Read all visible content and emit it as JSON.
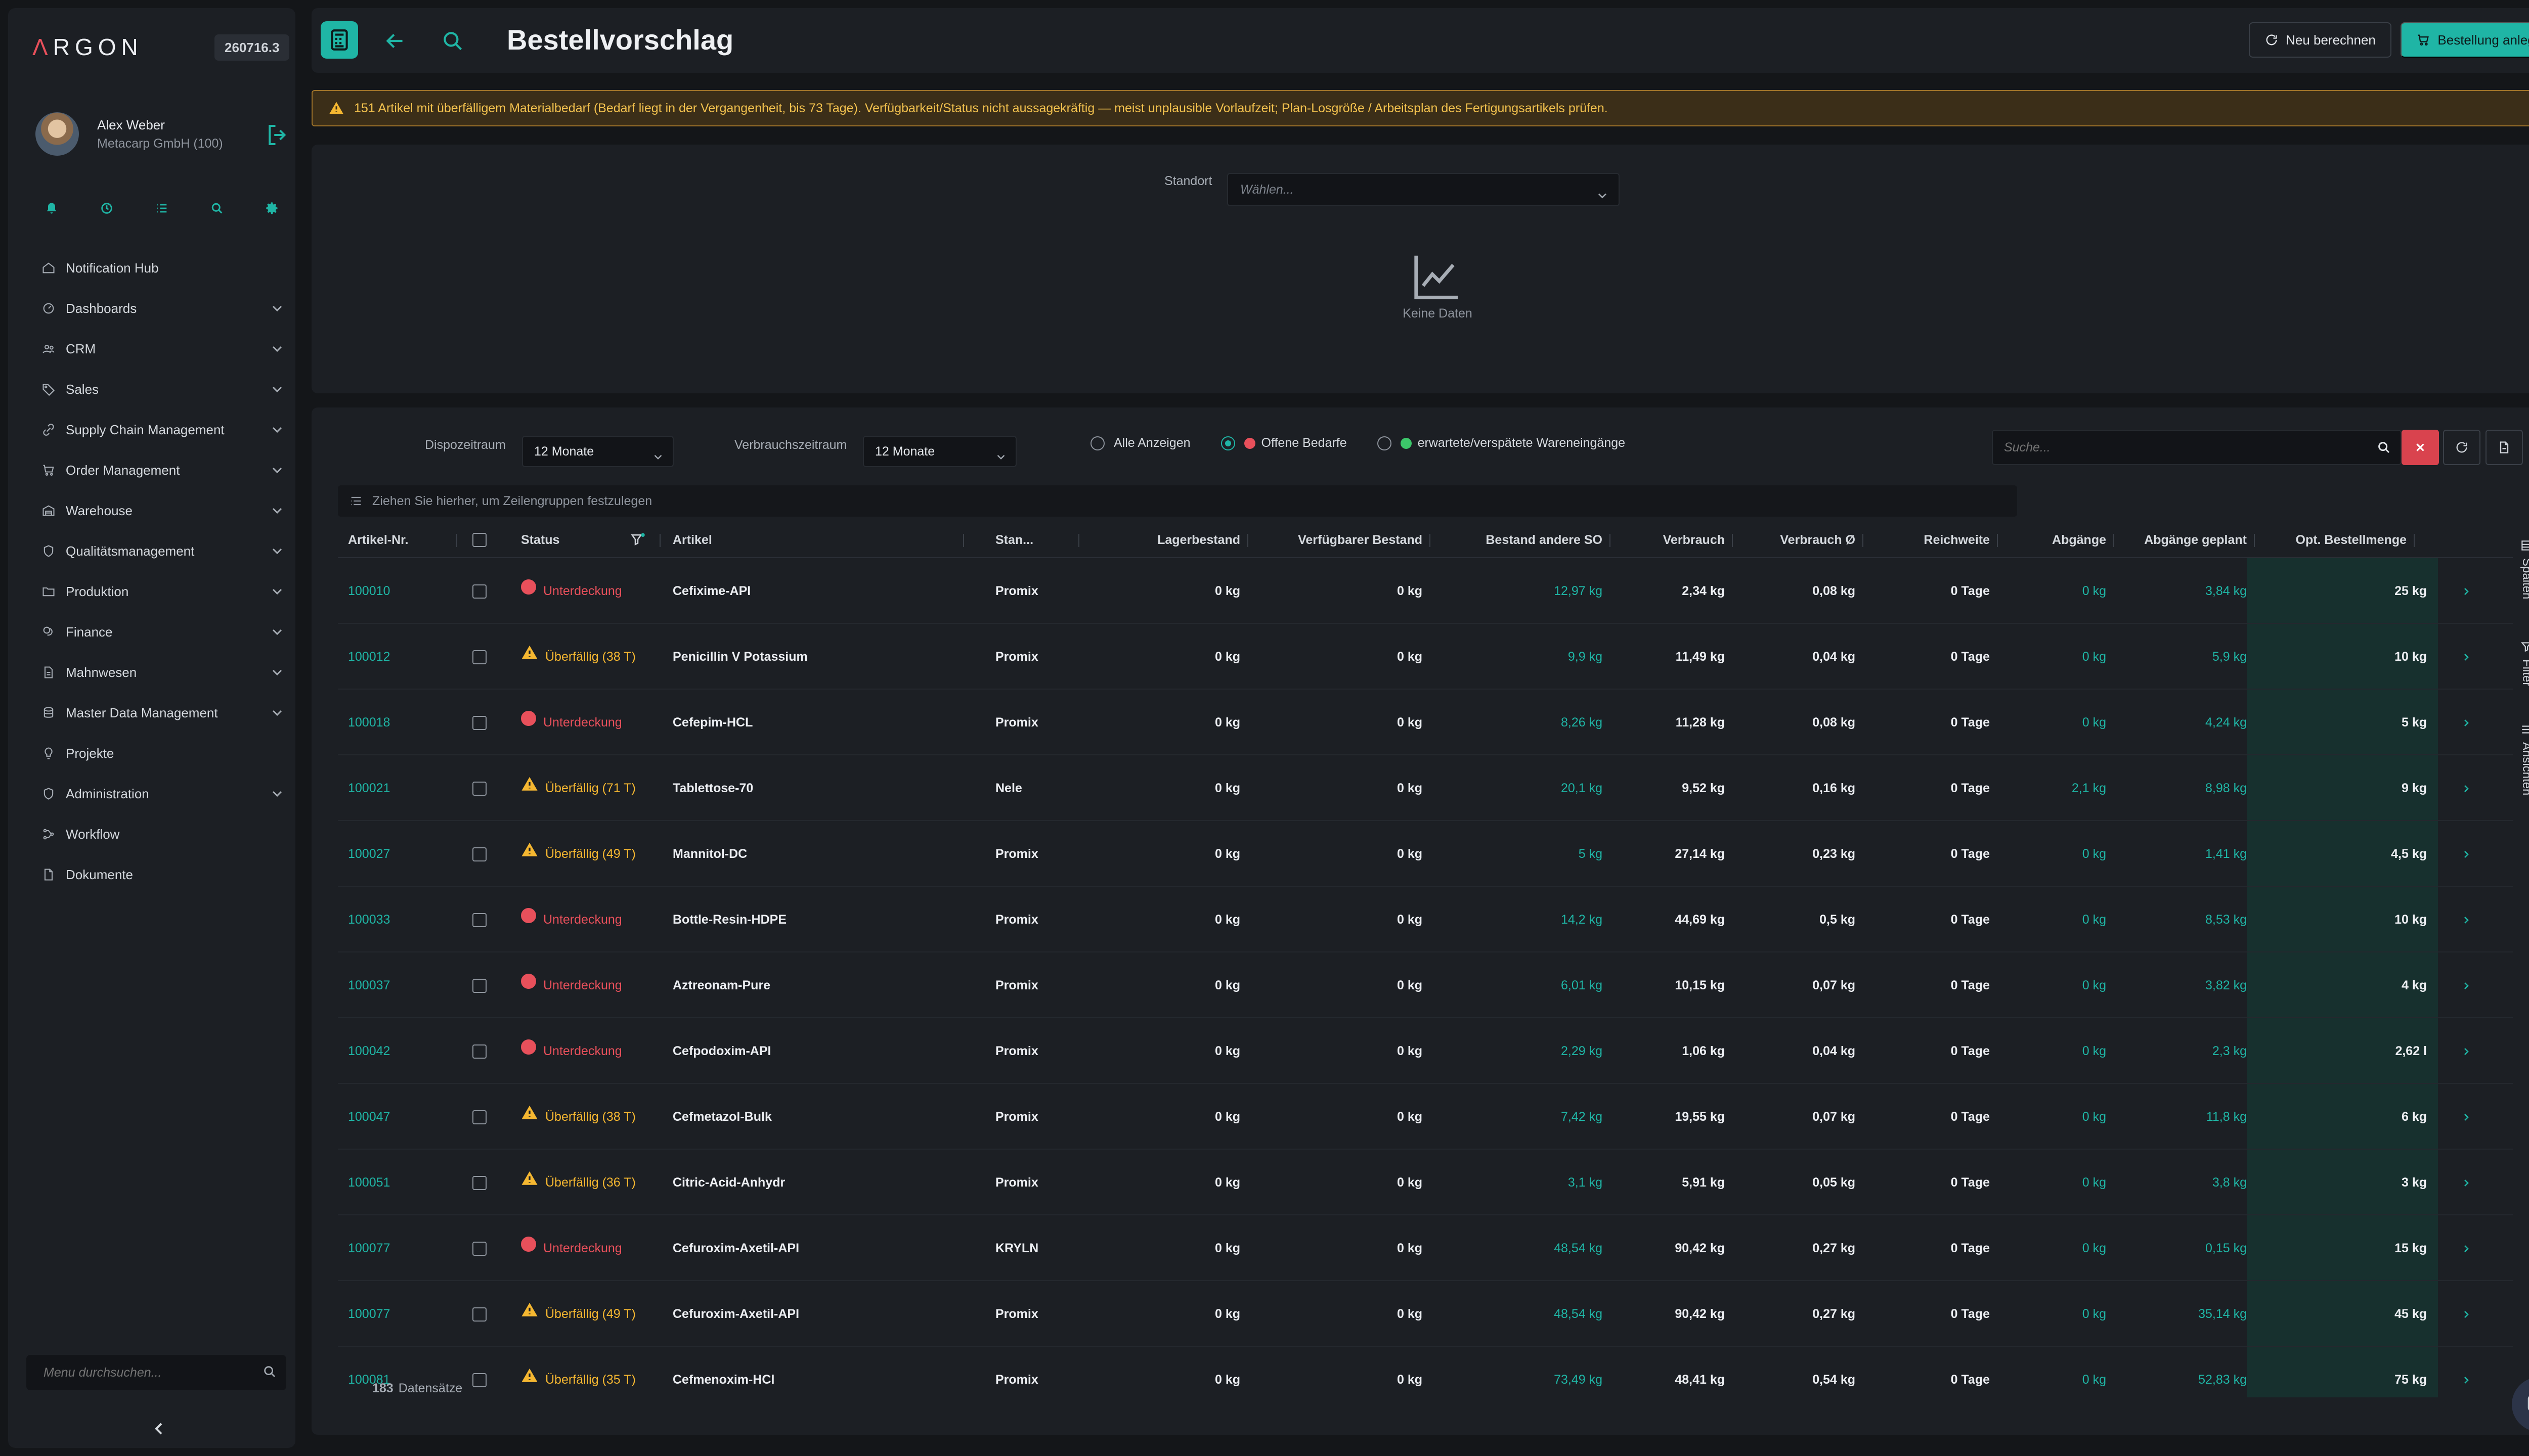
{
  "sidebar": {
    "brand_letter": "Λ",
    "brand_rest": "RGON",
    "version": "260716.3",
    "user_name": "Alex Weber",
    "user_company": "Metacarp GmbH (100)",
    "quick_icons": [
      "bell-icon",
      "clock-icon",
      "list-icon",
      "search-icon",
      "gear-icon"
    ],
    "items": [
      {
        "label": "Notification Hub",
        "icon": "home-icon",
        "expandable": false
      },
      {
        "label": "Dashboards",
        "icon": "gauge-icon",
        "expandable": true
      },
      {
        "label": "CRM",
        "icon": "users-icon",
        "expandable": true
      },
      {
        "label": "Sales",
        "icon": "tag-icon",
        "expandable": true
      },
      {
        "label": "Supply Chain Management",
        "icon": "link-icon",
        "expandable": true
      },
      {
        "label": "Order Management",
        "icon": "cart-icon",
        "expandable": true
      },
      {
        "label": "Warehouse",
        "icon": "warehouse-icon",
        "expandable": true
      },
      {
        "label": "Qualitätsmanagement",
        "icon": "shield-icon",
        "expandable": true
      },
      {
        "label": "Produktion",
        "icon": "folder-icon",
        "expandable": true
      },
      {
        "label": "Finance",
        "icon": "coins-icon",
        "expandable": true
      },
      {
        "label": "Mahnwesen",
        "icon": "document-icon",
        "expandable": true
      },
      {
        "label": "Master Data Management",
        "icon": "database-icon",
        "expandable": true
      },
      {
        "label": "Projekte",
        "icon": "bulb-icon",
        "expandable": false
      },
      {
        "label": "Administration",
        "icon": "shield-icon",
        "expandable": true
      },
      {
        "label": "Workflow",
        "icon": "workflow-icon",
        "expandable": false
      },
      {
        "label": "Dokumente",
        "icon": "file-icon",
        "expandable": false
      }
    ],
    "menu_search_placeholder": "Menu durchsuchen..."
  },
  "header": {
    "title": "Bestellvorschlag",
    "recalc_label": "Neu berechnen",
    "order_label": "Bestellung anlegen"
  },
  "warning": {
    "text": "151 Artikel mit überfälligem Materialbedarf (Bedarf liegt in der Vergangenheit, bis 73 Tage). Verfügbarkeit/Status nicht aussagekräftig — meist unplausible Vorlaufzeit; Plan-Losgröße / Arbeitsplan des Fertigungsartikels prüfen."
  },
  "chart_panel": {
    "standort_label": "Standort",
    "standort_placeholder": "Wählen...",
    "nodata_text": "Keine Daten"
  },
  "filters": {
    "dispo_label": "Dispozeitraum",
    "dispo_value": "12 Monate",
    "verbrauch_label": "Verbrauchszeitraum",
    "verbrauch_value": "12 Monate",
    "radio_all": "Alle Anzeigen",
    "radio_open": "Offene Bedarfe",
    "radio_expected": "erwartete/verspätete Wareneingänge",
    "selected_radio": "open",
    "search_placeholder": "Suche...",
    "colors": {
      "accent": "#1fb5a5",
      "danger": "#e8505b",
      "warning": "#f5b731",
      "success": "#3cc76a"
    }
  },
  "grid": {
    "group_hint": "Ziehen Sie hierher, um Zeilengruppen festzulegen",
    "columns": [
      "Artikel-Nr.",
      "Status",
      "Artikel",
      "Stan...",
      "Lagerbestand",
      "Verfügbarer Bestand",
      "Bestand andere SO",
      "Verbrauch",
      "Verbrauch Ø",
      "Reichweite",
      "Abgänge",
      "Abgänge geplant",
      "Opt. Bestellmenge"
    ],
    "rows": [
      {
        "nr": "100010",
        "status_type": "red",
        "status": "Unterdeckung",
        "artikel": "Cefixime-API",
        "standort": "Promix",
        "lager": "0 kg",
        "verf": "0 kg",
        "andere": "12,97 kg",
        "verbrauch": "2,34 kg",
        "avg": "0,08 kg",
        "reich": "0 Tage",
        "abg": "0 kg",
        "geplant": "3,84 kg",
        "opt": "25 kg"
      },
      {
        "nr": "100012",
        "status_type": "amber",
        "status": "Überfällig (38 T)",
        "artikel": "Penicillin V Potassium",
        "standort": "Promix",
        "lager": "0 kg",
        "verf": "0 kg",
        "andere": "9,9 kg",
        "verbrauch": "11,49 kg",
        "avg": "0,04 kg",
        "reich": "0 Tage",
        "abg": "0 kg",
        "geplant": "5,9 kg",
        "opt": "10 kg"
      },
      {
        "nr": "100018",
        "status_type": "red",
        "status": "Unterdeckung",
        "artikel": "Cefepim-HCL",
        "standort": "Promix",
        "lager": "0 kg",
        "verf": "0 kg",
        "andere": "8,26 kg",
        "verbrauch": "11,28 kg",
        "avg": "0,08 kg",
        "reich": "0 Tage",
        "abg": "0 kg",
        "geplant": "4,24 kg",
        "opt": "5 kg"
      },
      {
        "nr": "100021",
        "status_type": "amber",
        "status": "Überfällig (71 T)",
        "artikel": "Tablettose-70",
        "standort": "Nele",
        "lager": "0 kg",
        "verf": "0 kg",
        "andere": "20,1 kg",
        "verbrauch": "9,52 kg",
        "avg": "0,16 kg",
        "reich": "0 Tage",
        "abg": "2,1 kg",
        "geplant": "8,98 kg",
        "opt": "9 kg"
      },
      {
        "nr": "100027",
        "status_type": "amber",
        "status": "Überfällig (49 T)",
        "artikel": "Mannitol-DC",
        "standort": "Promix",
        "lager": "0 kg",
        "verf": "0 kg",
        "andere": "5 kg",
        "verbrauch": "27,14 kg",
        "avg": "0,23 kg",
        "reich": "0 Tage",
        "abg": "0 kg",
        "geplant": "1,41 kg",
        "opt": "4,5 kg"
      },
      {
        "nr": "100033",
        "status_type": "red",
        "status": "Unterdeckung",
        "artikel": "Bottle-Resin-HDPE",
        "standort": "Promix",
        "lager": "0 kg",
        "verf": "0 kg",
        "andere": "14,2 kg",
        "verbrauch": "44,69 kg",
        "avg": "0,5 kg",
        "reich": "0 Tage",
        "abg": "0 kg",
        "geplant": "8,53 kg",
        "opt": "10 kg"
      },
      {
        "nr": "100037",
        "status_type": "red",
        "status": "Unterdeckung",
        "artikel": "Aztreonam-Pure",
        "standort": "Promix",
        "lager": "0 kg",
        "verf": "0 kg",
        "andere": "6,01 kg",
        "verbrauch": "10,15 kg",
        "avg": "0,07 kg",
        "reich": "0 Tage",
        "abg": "0 kg",
        "geplant": "3,82 kg",
        "opt": "4 kg"
      },
      {
        "nr": "100042",
        "status_type": "red",
        "status": "Unterdeckung",
        "artikel": "Cefpodoxim-API",
        "standort": "Promix",
        "lager": "0 kg",
        "verf": "0 kg",
        "andere": "2,29 kg",
        "verbrauch": "1,06 kg",
        "avg": "0,04 kg",
        "reich": "0 Tage",
        "abg": "0 kg",
        "geplant": "2,3 kg",
        "opt": "2,62 l"
      },
      {
        "nr": "100047",
        "status_type": "amber",
        "status": "Überfällig (38 T)",
        "artikel": "Cefmetazol-Bulk",
        "standort": "Promix",
        "lager": "0 kg",
        "verf": "0 kg",
        "andere": "7,42 kg",
        "verbrauch": "19,55 kg",
        "avg": "0,07 kg",
        "reich": "0 Tage",
        "abg": "0 kg",
        "geplant": "11,8 kg",
        "opt": "6 kg"
      },
      {
        "nr": "100051",
        "status_type": "amber",
        "status": "Überfällig (36 T)",
        "artikel": "Citric-Acid-Anhydr",
        "standort": "Promix",
        "lager": "0 kg",
        "verf": "0 kg",
        "andere": "3,1 kg",
        "verbrauch": "5,91 kg",
        "avg": "0,05 kg",
        "reich": "0 Tage",
        "abg": "0 kg",
        "geplant": "3,8 kg",
        "opt": "3 kg"
      },
      {
        "nr": "100077",
        "status_type": "red",
        "status": "Unterdeckung",
        "artikel": "Cefuroxim-Axetil-API",
        "standort": "KRYLN",
        "lager": "0 kg",
        "verf": "0 kg",
        "andere": "48,54 kg",
        "verbrauch": "90,42 kg",
        "avg": "0,27 kg",
        "reich": "0 Tage",
        "abg": "0 kg",
        "geplant": "0,15 kg",
        "opt": "15 kg"
      },
      {
        "nr": "100077",
        "status_type": "amber",
        "status": "Überfällig (49 T)",
        "artikel": "Cefuroxim-Axetil-API",
        "standort": "Promix",
        "lager": "0 kg",
        "verf": "0 kg",
        "andere": "48,54 kg",
        "verbrauch": "90,42 kg",
        "avg": "0,27 kg",
        "reich": "0 Tage",
        "abg": "0 kg",
        "geplant": "35,14 kg",
        "opt": "45 kg"
      },
      {
        "nr": "100081",
        "status_type": "amber",
        "status": "Überfällig (35 T)",
        "artikel": "Cefmenoxim-HCl",
        "standort": "Promix",
        "lager": "0 kg",
        "verf": "0 kg",
        "andere": "73,49 kg",
        "verbrauch": "48,41 kg",
        "avg": "0,54 kg",
        "reich": "0 Tage",
        "abg": "0 kg",
        "geplant": "52,83 kg",
        "opt": "75 kg"
      }
    ],
    "side_tabs": [
      "Spalten",
      "Filter",
      "Ansichten"
    ],
    "record_count": "183",
    "record_label": "Datensätze"
  }
}
